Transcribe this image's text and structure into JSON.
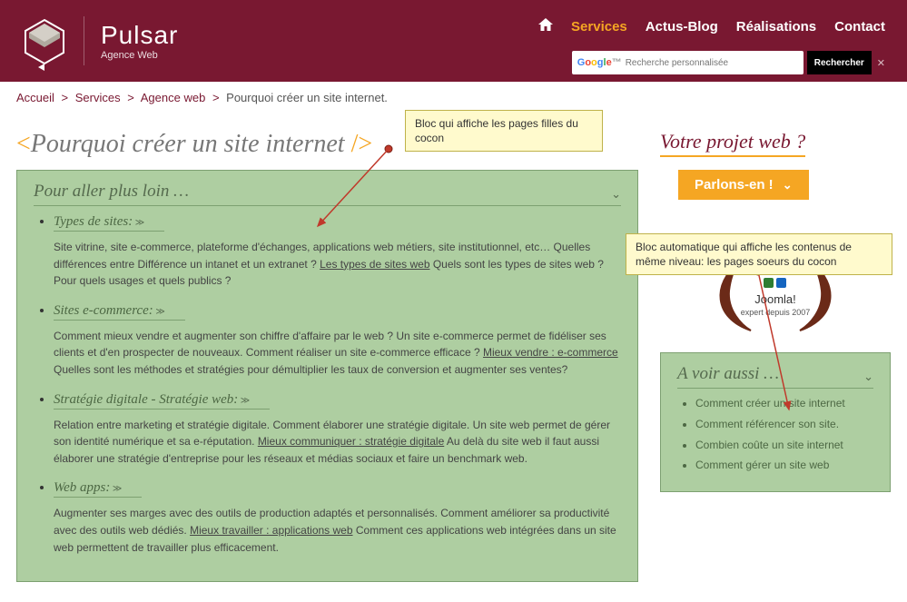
{
  "brand": {
    "name": "Pulsar",
    "tagline": "Agence Web"
  },
  "nav": {
    "items": [
      {
        "label": "Services",
        "active": true
      },
      {
        "label": "Actus-Blog",
        "active": false
      },
      {
        "label": "Réalisations",
        "active": false
      },
      {
        "label": "Contact",
        "active": false
      }
    ]
  },
  "search": {
    "placeholder": "Recherche personnalisée",
    "button": "Rechercher"
  },
  "breadcrumb": {
    "items": [
      "Accueil",
      "Services",
      "Agence web"
    ],
    "current": "Pourquoi créer un site internet.",
    "sep": ">"
  },
  "page_title": "Pourquoi créer un site internet",
  "more_block": {
    "title": "Pour aller plus loin …",
    "sections": [
      {
        "title": "Types de sites:",
        "text_before": "Site vitrine, site e-commerce, plateforme d'échanges, applications web métiers, site institutionnel, etc… Quelles différences entre Différence un intanet et un extranet ? ",
        "link": "Les types de sites web",
        "text_after": " Quels sont les types de sites web ? Pour quels usages et quels publics ?"
      },
      {
        "title": "Sites e-commerce:",
        "text_before": "Comment mieux vendre et augmenter son chiffre d'affaire par le web ? Un site e-commerce permet de fidéliser ses clients et d'en prospecter de nouveaux. Comment réaliser un site e-commerce efficace ? ",
        "link": "Mieux vendre : e-commerce",
        "text_after": " Quelles sont les méthodes et stratégies pour démultiplier les taux de conversion et augmenter ses ventes?"
      },
      {
        "title": "Stratégie digitale - Stratégie web:",
        "text_before": "Relation entre marketing et stratégie digitale. Comment élaborer une stratégie digitale. Un site web permet de gérer son identité numérique et sa e-réputation. ",
        "link": "Mieux communiquer : stratégie digitale",
        "text_after": " Au delà du site web il faut aussi élaborer une stratégie d'entreprise pour les réseaux et médias sociaux et faire un benchmark web."
      },
      {
        "title": "Web apps:",
        "text_before": "Augmenter ses marges avec des outils de production adaptés et personnalisés. Comment améliorer sa productivité avec des outils web dédiés. ",
        "link": "Mieux travailler : applications web",
        "text_after": " Comment ces applications web intégrées dans un site web permettent de travailler plus efficacement."
      }
    ]
  },
  "sidebar": {
    "project_title": "Votre projet web ?",
    "cta": "Parlons-en !",
    "joomla": {
      "name": "Joomla!",
      "sub": "expert depuis 2007"
    },
    "related": {
      "title": "A voir aussi …",
      "items": [
        "Comment créer un site internet",
        "Comment référencer son site.",
        "Combien coûte un site internet",
        "Comment gérer un site web"
      ]
    }
  },
  "annotations": {
    "top": "Bloc qui affiche les pages filles du cocon",
    "side": "Bloc automatique qui affiche les contenus de même niveau: les pages soeurs du cocon"
  }
}
